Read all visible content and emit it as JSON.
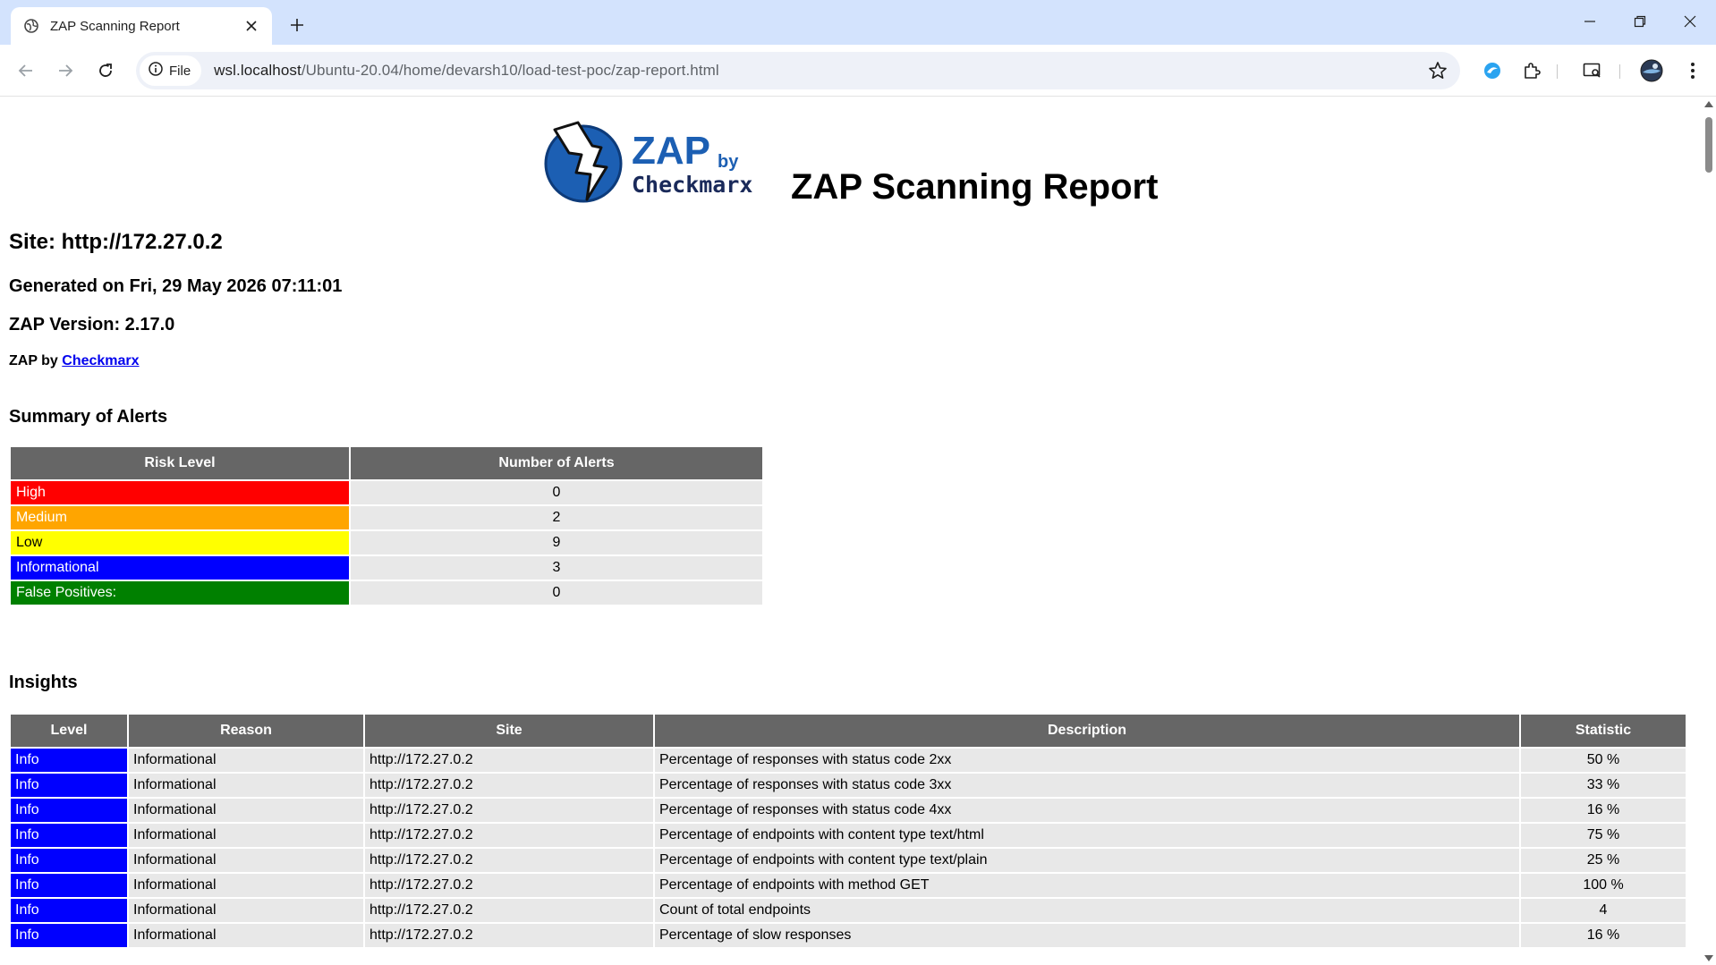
{
  "browser": {
    "tab_title": "ZAP Scanning Report",
    "url_chip": "File",
    "url_host": "wsl.localhost",
    "url_path": "/Ubuntu-20.04/home/devarsh10/load-test-poc/zap-report.html"
  },
  "report": {
    "logo_zap": "ZAP",
    "logo_by": "by",
    "logo_checkmarx": "Checkmarx",
    "title": "ZAP Scanning Report",
    "site": "Site: http://172.27.0.2",
    "generated": "Generated on Fri, 29 May 2026 07:11:01",
    "version": "ZAP Version: 2.17.0",
    "zap_by_prefix": "ZAP by",
    "zap_by_link": "Checkmarx"
  },
  "summary": {
    "heading": "Summary of Alerts",
    "col_risk": "Risk Level",
    "col_count": "Number of Alerts",
    "rows": [
      {
        "risk": "High",
        "count": "0",
        "color": "#ff0000",
        "text_color": "#ffffff"
      },
      {
        "risk": "Medium",
        "count": "2",
        "color": "#ffa500",
        "text_color": "#ffffff"
      },
      {
        "risk": "Low",
        "count": "9",
        "color": "#ffff00",
        "text_color": "#000000"
      },
      {
        "risk": "Informational",
        "count": "3",
        "color": "#0000ff",
        "text_color": "#ffffff"
      },
      {
        "risk": "False Positives:",
        "count": "0",
        "color": "#008000",
        "text_color": "#ffffff"
      }
    ]
  },
  "insights": {
    "heading": "Insights",
    "columns": [
      "Level",
      "Reason",
      "Site",
      "Description",
      "Statistic"
    ],
    "rows": [
      {
        "level": "Info",
        "reason": "Informational",
        "site": "http://172.27.0.2",
        "description": "Percentage of responses with status code 2xx",
        "statistic": "50 %"
      },
      {
        "level": "Info",
        "reason": "Informational",
        "site": "http://172.27.0.2",
        "description": "Percentage of responses with status code 3xx",
        "statistic": "33 %"
      },
      {
        "level": "Info",
        "reason": "Informational",
        "site": "http://172.27.0.2",
        "description": "Percentage of responses with status code 4xx",
        "statistic": "16 %"
      },
      {
        "level": "Info",
        "reason": "Informational",
        "site": "http://172.27.0.2",
        "description": "Percentage of endpoints with content type text/html",
        "statistic": "75 %"
      },
      {
        "level": "Info",
        "reason": "Informational",
        "site": "http://172.27.0.2",
        "description": "Percentage of endpoints with content type text/plain",
        "statistic": "25 %"
      },
      {
        "level": "Info",
        "reason": "Informational",
        "site": "http://172.27.0.2",
        "description": "Percentage of endpoints with method GET",
        "statistic": "100 %"
      },
      {
        "level": "Info",
        "reason": "Informational",
        "site": "http://172.27.0.2",
        "description": "Count of total endpoints",
        "statistic": "4"
      },
      {
        "level": "Info",
        "reason": "Informational",
        "site": "http://172.27.0.2",
        "description": "Percentage of slow responses",
        "statistic": "16 %"
      }
    ]
  }
}
